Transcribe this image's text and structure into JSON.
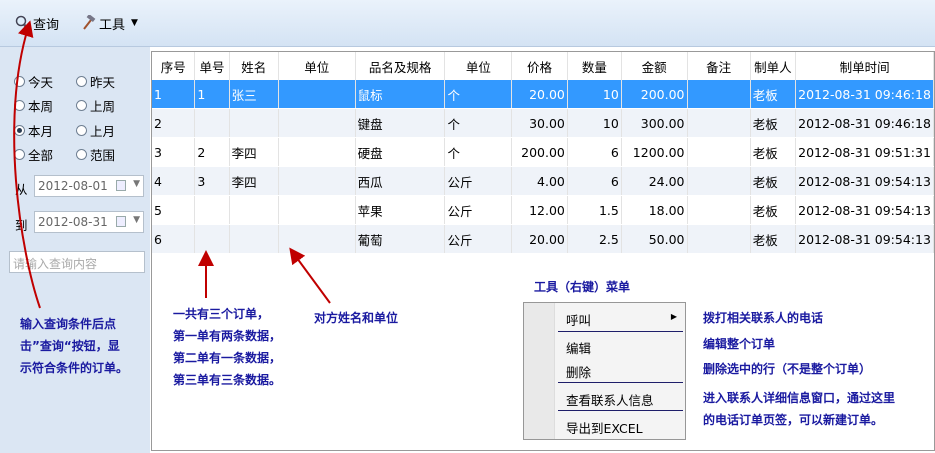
{
  "toolbar": {
    "query_label": "查询",
    "tools_label": "工具"
  },
  "sidebar": {
    "radios": [
      {
        "label": "今天",
        "checked": false
      },
      {
        "label": "昨天",
        "checked": false
      },
      {
        "label": "本周",
        "checked": false
      },
      {
        "label": "上周",
        "checked": false
      },
      {
        "label": "本月",
        "checked": true
      },
      {
        "label": "上月",
        "checked": false
      },
      {
        "label": "全部",
        "checked": false
      },
      {
        "label": "范围",
        "checked": false
      }
    ],
    "from_label": "从",
    "from_value": "2012-08-01",
    "to_label": "到",
    "to_value": "2012-08-31",
    "search_placeholder": "请输入查询内容"
  },
  "table": {
    "headers": [
      "序号",
      "单号",
      "姓名",
      "单位",
      "品名及规格",
      "单位",
      "价格",
      "数量",
      "金额",
      "备注",
      "制单人",
      "制单时间"
    ],
    "rows": [
      [
        "1",
        "1",
        "张三",
        "",
        "鼠标",
        "个",
        "20.00",
        "10",
        "200.00",
        "",
        "老板",
        "2012-08-31 09:46:18"
      ],
      [
        "2",
        "",
        "",
        "",
        "键盘",
        "个",
        "30.00",
        "10",
        "300.00",
        "",
        "老板",
        "2012-08-31 09:46:18"
      ],
      [
        "3",
        "2",
        "李四",
        "",
        "硬盘",
        "个",
        "200.00",
        "6",
        "1200.00",
        "",
        "老板",
        "2012-08-31 09:51:31"
      ],
      [
        "4",
        "3",
        "李四",
        "",
        "西瓜",
        "公斤",
        "4.00",
        "6",
        "24.00",
        "",
        "老板",
        "2012-08-31 09:54:13"
      ],
      [
        "5",
        "",
        "",
        "",
        "苹果",
        "公斤",
        "12.00",
        "1.5",
        "18.00",
        "",
        "老板",
        "2012-08-31 09:54:13"
      ],
      [
        "6",
        "",
        "",
        "",
        "葡萄",
        "公斤",
        "20.00",
        "2.5",
        "50.00",
        "",
        "老板",
        "2012-08-31 09:54:13"
      ]
    ],
    "selected_row": 0
  },
  "annotations": {
    "query_note": [
      "输入查询条件后点",
      "击”查询“按钮，显",
      "示符合条件的订单。"
    ],
    "orders_note": [
      "一共有三个订单，",
      "第一单有两条数据，",
      "第二单有一条数据，",
      "第三单有三条数据。"
    ],
    "name_note": "对方姓名和单位",
    "menu_title": "工具（右键）菜单",
    "call_note": "拨打相关联系人的电话",
    "edit_note": "编辑整个订单",
    "delete_note": "删除选中的行（不是整个订单）",
    "contact_note": [
      "进入联系人详细信息窗口，通过这里",
      "的电话订单页签，可以新建订单。"
    ]
  },
  "menu": {
    "items": [
      "呼叫",
      "编辑",
      "删除",
      "查看联系人信息",
      "导出到EXCEL"
    ],
    "submenu_arrow": "▶"
  },
  "colors": {
    "selection": "#3399ff",
    "annotation": "#1a1aa0",
    "arrow": "#c00000"
  },
  "icons": {
    "query": "magnifier-icon",
    "tools": "hammer-icon"
  }
}
